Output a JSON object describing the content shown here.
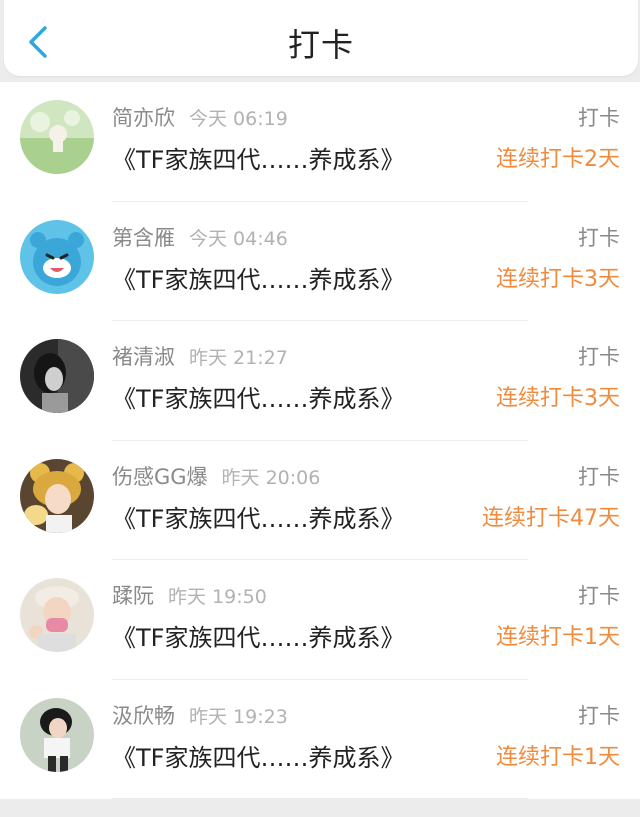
{
  "header": {
    "title": "打卡"
  },
  "colors": {
    "accent": "#2ea7e0",
    "streak": "#f08a3c"
  },
  "entries": [
    {
      "name": "简亦欣",
      "time": "今天 06:19",
      "action": "打卡",
      "book": "《TF家族四代……养成系》",
      "streak": "连续打卡2天"
    },
    {
      "name": "第含雁",
      "time": "今天 04:46",
      "action": "打卡",
      "book": "《TF家族四代……养成系》",
      "streak": "连续打卡3天"
    },
    {
      "name": "褚清淑",
      "time": "昨天 21:27",
      "action": "打卡",
      "book": "《TF家族四代……养成系》",
      "streak": "连续打卡3天"
    },
    {
      "name": "伤感GG爆",
      "time": "昨天 20:06",
      "action": "打卡",
      "book": "《TF家族四代……养成系》",
      "streak": "连续打卡47天"
    },
    {
      "name": "蹂阮",
      "time": "昨天 19:50",
      "action": "打卡",
      "book": "《TF家族四代……养成系》",
      "streak": "连续打卡1天"
    },
    {
      "name": "汲欣畅",
      "time": "昨天 19:23",
      "action": "打卡",
      "book": "《TF家族四代……养成系》",
      "streak": "连续打卡1天"
    }
  ]
}
